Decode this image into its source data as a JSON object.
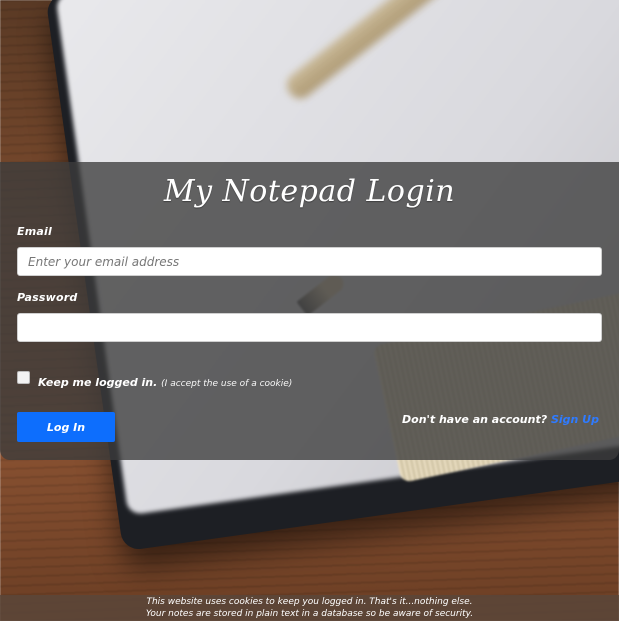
{
  "login": {
    "title": "My Notepad Login",
    "email_label": "Email",
    "email_placeholder": "Enter your email address",
    "email_value": "",
    "password_label": "Password",
    "password_value": "",
    "remember_label": "Keep me logged in.",
    "remember_note": "(I accept the use of a cookie)",
    "login_button": "Log In",
    "signup_prompt": "Don't have an account?",
    "signup_link": "Sign Up"
  },
  "footer": {
    "line1": "This website uses cookies to keep you logged in. That's it...nothing else.",
    "line2": "Your notes are stored in plain text in a database so be aware of security."
  }
}
